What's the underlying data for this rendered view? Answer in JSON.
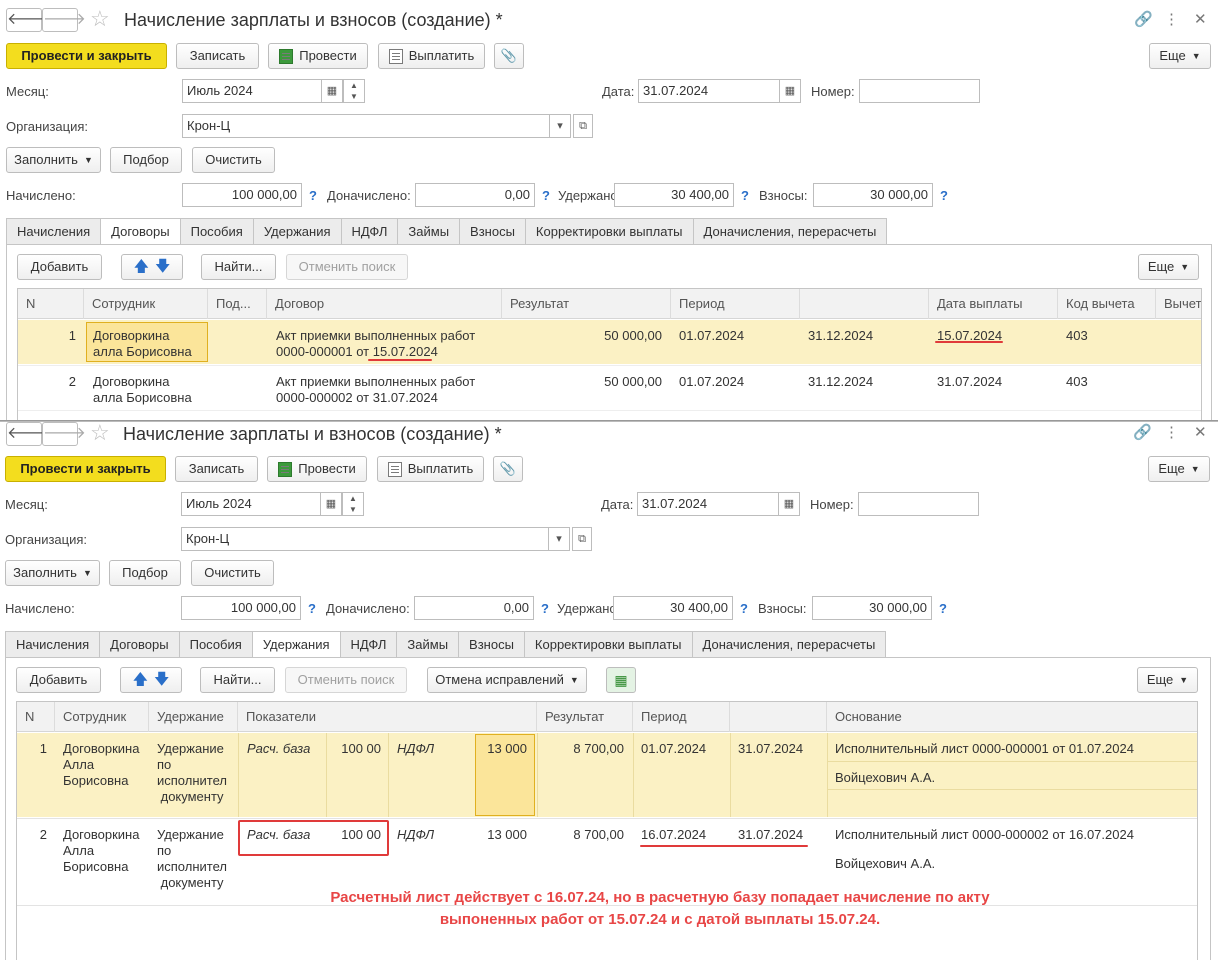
{
  "w1": {
    "title": "Начисление зарплаты и взносов (создание) *",
    "toolbar": {
      "post_close": "Провести и закрыть",
      "save": "Записать",
      "post": "Провести",
      "pay": "Выплатить",
      "more": "Еще"
    },
    "month_label": "Месяц:",
    "month_value": "Июль 2024",
    "date_label": "Дата:",
    "date_value": "31.07.2024",
    "number_label": "Номер:",
    "org_label": "Организация:",
    "org_value": "Крон-Ц",
    "fill": "Заполнить",
    "select": "Подбор",
    "clear": "Очистить",
    "accrued_label": "Начислено:",
    "accrued": "100 000,00",
    "additional_label": "Доначислено:",
    "additional": "0,00",
    "withheld_label": "Удержано:",
    "withheld": "30 400,00",
    "contrib_label": "Взносы:",
    "contrib": "30 000,00",
    "q": "?",
    "tabs": [
      "Начисления",
      "Договоры",
      "Пособия",
      "Удержания",
      "НДФЛ",
      "Займы",
      "Взносы",
      "Корректировки выплаты",
      "Доначисления, перерасчеты"
    ],
    "panel": {
      "add": "Добавить",
      "find": "Найти...",
      "cancel_find": "Отменить поиск",
      "more": "Еще"
    },
    "columns": [
      "N",
      "Сотрудник",
      "Под...",
      "Договор",
      "Результат",
      "Период",
      "",
      "Дата выплаты",
      "Код вычета",
      "Вычет"
    ],
    "rows": [
      {
        "n": "1",
        "emp1": "Договоркина",
        "emp2": "алла Борисовна",
        "contract1": "Акт приемки выполненных работ",
        "contract2a": "0000-000001 от ",
        "contract2b": "15.07.2024",
        "result": "50 000,00",
        "p1": "01.07.2024",
        "p2": "31.12.2024",
        "paydate": "15.07.2024",
        "code": "403"
      },
      {
        "n": "2",
        "emp1": "Договоркина",
        "emp2": "алла Борисовна",
        "contract1": "Акт приемки выполненных работ",
        "contract2a": "0000-000002 от 31.07.2024",
        "contract2b": "",
        "result": "50 000,00",
        "p1": "01.07.2024",
        "p2": "31.12.2024",
        "paydate": "31.07.2024",
        "code": "403"
      }
    ]
  },
  "w2": {
    "title": "Начисление зарплаты и взносов (создание) *",
    "toolbar": {
      "post_close": "Провести и закрыть",
      "save": "Записать",
      "post": "Провести",
      "pay": "Выплатить",
      "more": "Еще"
    },
    "month_label": "Месяц:",
    "month_value": "Июль 2024",
    "date_label": "Дата:",
    "date_value": "31.07.2024",
    "number_label": "Номер:",
    "org_label": "Организация:",
    "org_value": "Крон-Ц",
    "fill": "Заполнить",
    "select": "Подбор",
    "clear": "Очистить",
    "accrued_label": "Начислено:",
    "accrued": "100 000,00",
    "additional_label": "Доначислено:",
    "additional": "0,00",
    "withheld_label": "Удержано:",
    "withheld": "30 400,00",
    "contrib_label": "Взносы:",
    "contrib": "30 000,00",
    "q": "?",
    "tabs": [
      "Начисления",
      "Договоры",
      "Пособия",
      "Удержания",
      "НДФЛ",
      "Займы",
      "Взносы",
      "Корректировки выплаты",
      "Доначисления, перерасчеты"
    ],
    "panel": {
      "add": "Добавить",
      "find": "Найти...",
      "cancel_find": "Отменить поиск",
      "cancel_corr": "Отмена исправлений",
      "more": "Еще"
    },
    "columns": [
      "N",
      "Сотрудник",
      "Удержание",
      "Показатели",
      "Результат",
      "Период",
      "",
      "Основание"
    ],
    "rows": [
      {
        "n": "1",
        "emp": [
          "Договоркина",
          "Алла",
          "Борисовна"
        ],
        "ded": [
          "Удержание",
          "по",
          "исполнител",
          " документу"
        ],
        "ind_name": "Расч. база",
        "ind_val": "100 00",
        "tax": "НДФЛ",
        "tax_val": "13 000",
        "result": "8 700,00",
        "p1": "01.07.2024",
        "p2": "31.07.2024",
        "basis": "Исполнительный лист 0000-000001 от 01.07.2024",
        "person": "Войцехович А.А."
      },
      {
        "n": "2",
        "emp": [
          "Договоркина",
          "Алла",
          "Борисовна"
        ],
        "ded": [
          "Удержание",
          "по",
          "исполнител",
          " документу"
        ],
        "ind_name": "Расч. база",
        "ind_val": "100 00",
        "tax": "НДФЛ",
        "tax_val": "13 000",
        "result": "8 700,00",
        "p1": "16.07.2024",
        "p2": "31.07.2024",
        "basis": "Исполнительный лист 0000-000002 от 16.07.2024",
        "person": "Войцехович А.А."
      }
    ],
    "note_line1": "Расчетный лист действует с 16.07.24, но в расчетную базу попадает  начисление по акту",
    "note_line2": "выпоненных работ от 15.07.24 и с датой выплаты 15.07.24."
  }
}
